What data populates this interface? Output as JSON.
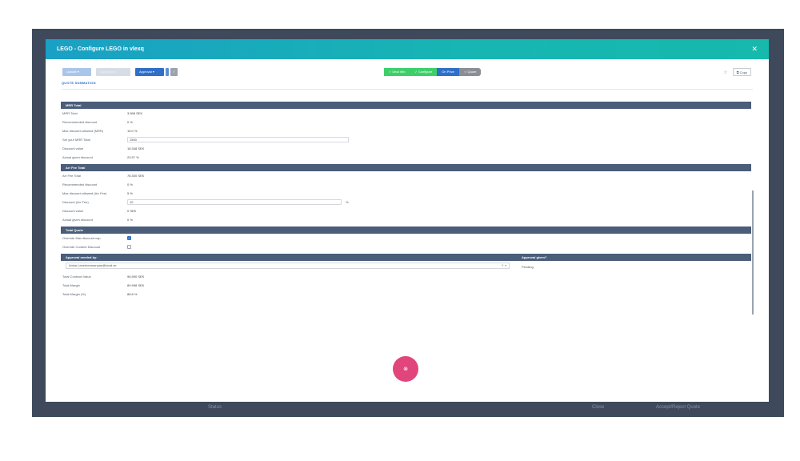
{
  "modal": {
    "title": "LEGO - Configure LEGO in vlexq",
    "close_icon": "✕"
  },
  "toolbar": {
    "btn1": "Update ▾",
    "btn2": "Operations",
    "approval": "Approval ▾",
    "gray_icon": "✓",
    "steps": [
      "✓ Deal Info",
      "✓ Configure",
      "On Price",
      "☆ Quote"
    ],
    "fav_icon": "☆",
    "copy_label": "⧉ Copy"
  },
  "tab": "QUOTE SUMMATION",
  "sections": {
    "mrr": {
      "title": "MRR Total",
      "rows": [
        {
          "label": "MRR Total",
          "value": "3.898 SEK"
        },
        {
          "label": "Recommended discount",
          "value": "0 %"
        },
        {
          "label": "Max discount allowed (MRR)",
          "value": "15.0 %"
        },
        {
          "label": "Set your MRR Total",
          "input": "1500"
        },
        {
          "label": "Discount value",
          "value": "18.348 SEK"
        },
        {
          "label": "Actual given discount",
          "value": "23.97 %"
        }
      ]
    },
    "arr": {
      "title": "Arr Fee Total",
      "rows": [
        {
          "label": "Arr Fee Total",
          "value": "78.300 SEK"
        },
        {
          "label": "Recommended discount",
          "value": "0 %"
        },
        {
          "label": "Max discount allowed (Arr Fee)",
          "value": "5 %"
        },
        {
          "label": "Discount (Arr Fee)",
          "input": "10",
          "unit": "%"
        },
        {
          "label": "Discount value",
          "value": "0 SEK"
        },
        {
          "label": "Actual given discount",
          "value": "0 %"
        }
      ]
    },
    "quote": {
      "title": "Total Quote",
      "rows": [
        {
          "label": "Override Max discount cap",
          "checked": true
        },
        {
          "label": "Override Content Discount",
          "checked": false
        }
      ]
    },
    "approval": {
      "title_left": "Approval needed by:",
      "title_right": "Approval given?",
      "select_value": "Anisa Lesertommanyan@local.se",
      "select_arrows": "✕ ▾",
      "status": "Pending",
      "rows": [
        {
          "label": "Total Contract Value",
          "value": "96.590 SEK"
        },
        {
          "label": "Total Margin",
          "value": "89.998 SEK"
        },
        {
          "label": "Total Margin (%)",
          "value": "88.8 %"
        }
      ]
    }
  },
  "fab_icon": "⊗",
  "background": {
    "text1": "Status",
    "text2": "Close",
    "text3": "Accept/Reject Quote"
  }
}
